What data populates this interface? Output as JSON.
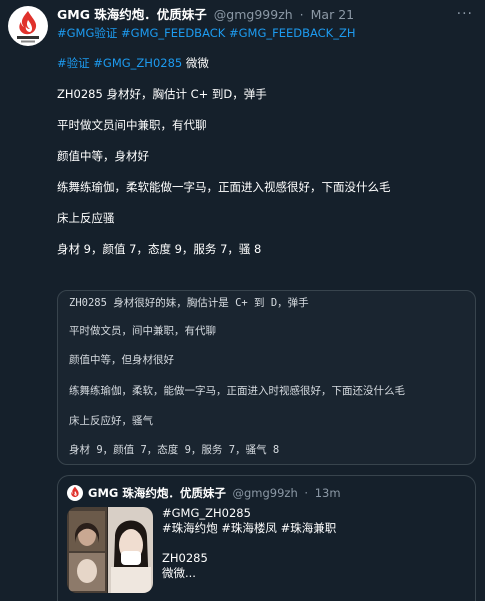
{
  "tweet": {
    "display_name": "GMG 珠海约炮．优质妹子",
    "handle": "@gmg999zh",
    "separator": "·",
    "date": "Mar 21",
    "more_label": "···",
    "hashtags": [
      "#GMG验证",
      "#GMG_FEEDBACK",
      "#GMG_FEEDBACK_ZH"
    ],
    "tagline": {
      "tags": [
        "#验证",
        "#GMG_ZH0285"
      ],
      "rest": "微微"
    },
    "lines": [
      "ZH0285 身材好，胸估计 C+ 到D，弹手",
      "平时做文员间中兼职，有代聊",
      "颜值中等，身材好",
      "练舞练瑜伽，柔软能做一字马，正面进入视感很好，下面没什么毛",
      "床上反应骚",
      "身材 9，颜值 7，态度 9，服务 7，骚 8"
    ]
  },
  "code_block": {
    "lines": [
      "ZH0285 身材很好的妹，胸估计是 C+ 到 D，弹手",
      "平时做文员，间中兼职，有代聊",
      "颜值中等，但身材很好",
      "练舞练瑜伽，柔软，能做一字马，正面进入时视感很好，下面还没什么毛",
      "床上反应好，骚气",
      "身材 9，颜值 7，态度 9，服务 7，骚气 8"
    ]
  },
  "quote": {
    "display_name": "GMG 珠海约炮．优质妹子",
    "handle": "@gmg99zh",
    "separator": "·",
    "time": "13m",
    "lines": [
      "#GMG_ZH0285",
      "#珠海约炮 #珠海楼凤 #珠海兼职",
      "",
      "ZH0285",
      "微微..."
    ]
  },
  "colors": {
    "background": "#15202b",
    "link": "#1d9bf0",
    "muted": "#8b98a5",
    "border": "#38444d",
    "logo_red": "#e0322c"
  },
  "icons": {
    "avatar": "gmg-logo-icon",
    "more": "more-icon"
  }
}
